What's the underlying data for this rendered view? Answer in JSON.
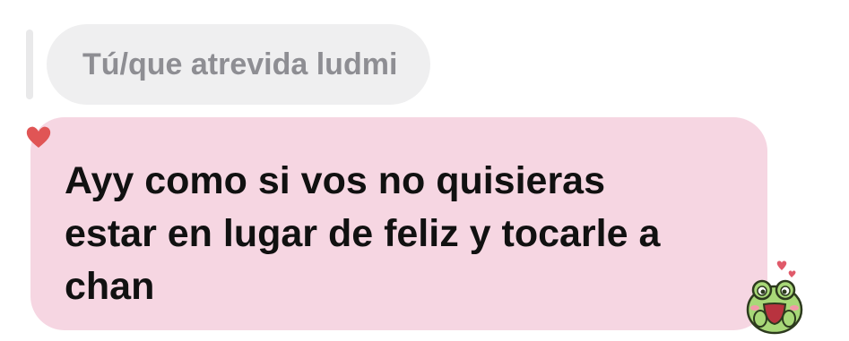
{
  "quoted_reply": {
    "text": "Tú/que atrevida ludmi"
  },
  "message": {
    "lines": [
      "Ayy como si vos no quisieras",
      "estar en lugar de feliz y tocarle a",
      "chan"
    ],
    "bubble_color": "#f6d6e2"
  },
  "reaction": {
    "icon": "heart-icon",
    "color": "#e05555"
  },
  "sticker": {
    "icon": "frog-sticker-icon"
  }
}
